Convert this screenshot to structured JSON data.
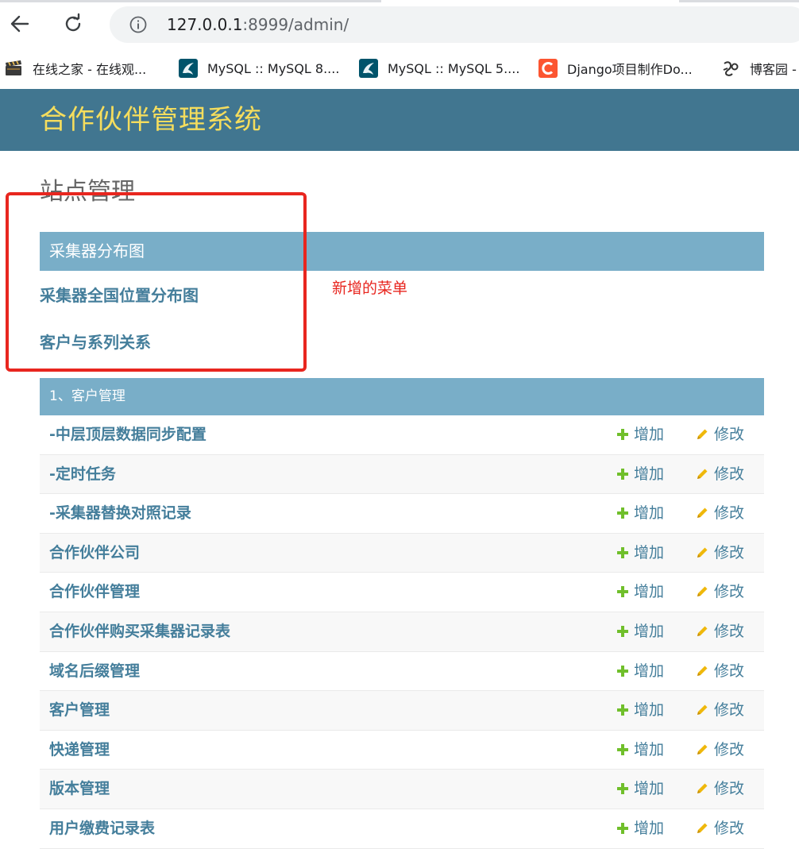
{
  "browser": {
    "url_host": "127.0.0.1",
    "url_rest": ":8999/admin/",
    "bookmarks": [
      {
        "label": "在线之家 - 在线观...",
        "icon": "clapperboard-icon"
      },
      {
        "label": "MySQL :: MySQL 8....",
        "icon": "mysql-dolphin-icon"
      },
      {
        "label": "MySQL :: MySQL 5....",
        "icon": "mysql-dolphin-icon"
      },
      {
        "label": "Django项目制作Do...",
        "icon": "csdn-c-icon"
      },
      {
        "label": "博客园 -",
        "icon": "cnblogs-icon"
      }
    ]
  },
  "header": {
    "site_title": "合作伙伴管理系统"
  },
  "page": {
    "title": "站点管理"
  },
  "collector_module": {
    "caption": "采集器分布图",
    "links": [
      "采集器全国位置分布图",
      "客户与系列关系"
    ]
  },
  "annotation": {
    "text": "新增的菜单",
    "color": "#e8261f"
  },
  "customer_module": {
    "caption": "1、客户管理",
    "add_label": "增加",
    "change_label": "修改",
    "rows": [
      "-中层顶层数据同步配置",
      "-定时任务",
      "-采集器替换对照记录",
      "合作伙伴公司",
      "合作伙伴管理",
      "合作伙伴购买采集器记录表",
      "域名后缀管理",
      "客户管理",
      "快递管理",
      "版本管理",
      "用户缴费记录表"
    ]
  },
  "colors": {
    "header_bg": "#417690",
    "site_title": "#f5dd5d",
    "caption_bg": "#79aec8",
    "link": "#447e9b",
    "add_icon": "#70bf2b",
    "change_icon": "#efb80b"
  }
}
